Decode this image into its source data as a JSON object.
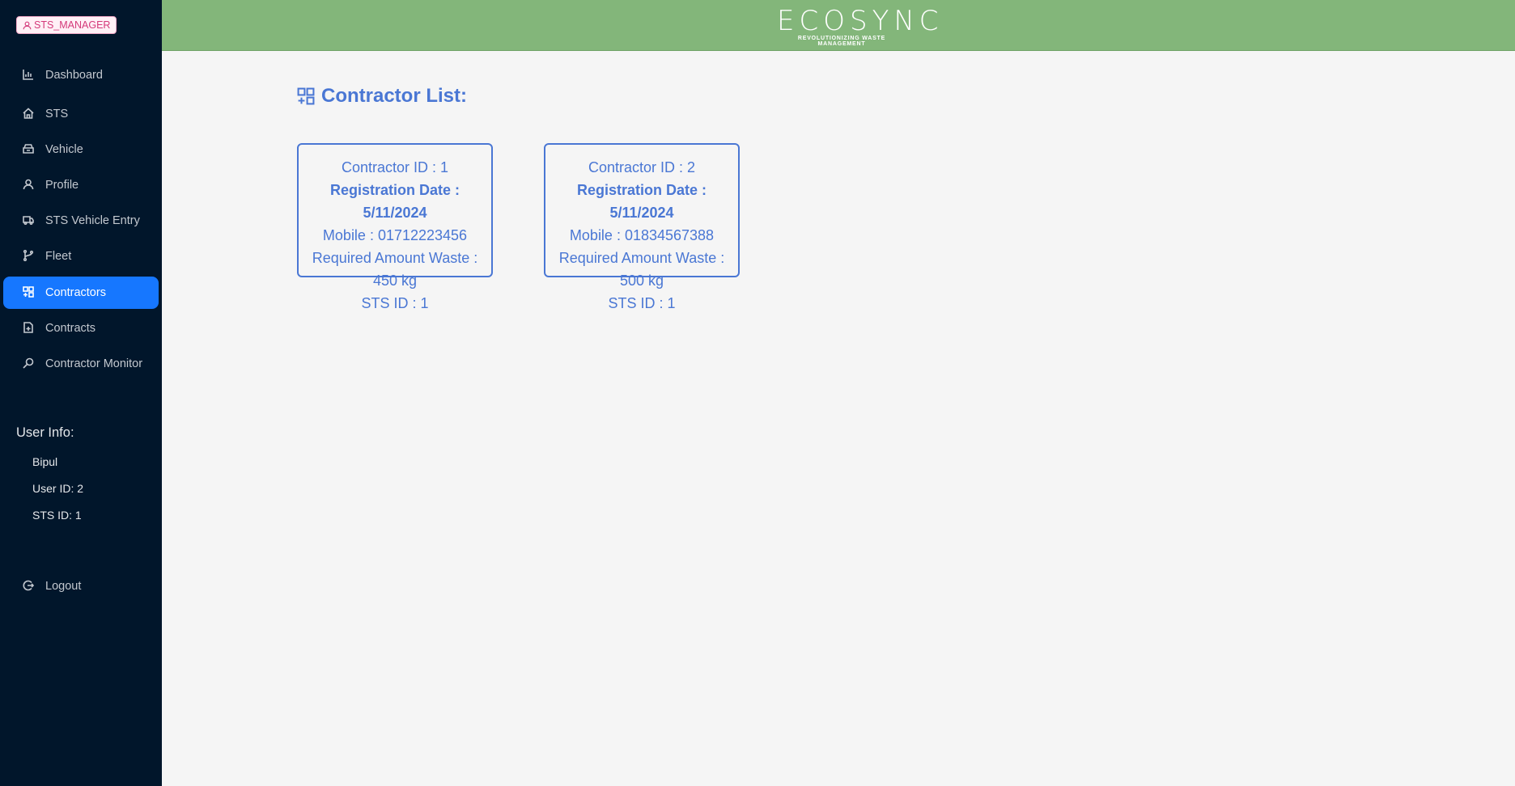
{
  "role_badge": "STS_MANAGER",
  "nav": [
    {
      "label": "Dashboard",
      "icon": "bar-chart-icon"
    },
    {
      "label": "STS",
      "icon": "home-icon"
    },
    {
      "label": "Vehicle",
      "icon": "car-icon"
    },
    {
      "label": "Profile",
      "icon": "user-icon"
    },
    {
      "label": "STS Vehicle Entry",
      "icon": "truck-icon"
    },
    {
      "label": "Fleet",
      "icon": "branch-icon"
    },
    {
      "label": "Contractors",
      "icon": "appstore-add-icon",
      "active": true
    },
    {
      "label": "Contracts",
      "icon": "file-add-icon"
    },
    {
      "label": "Contractor Monitor",
      "icon": "monitor-search-icon"
    }
  ],
  "user_info": {
    "title": "User Info:",
    "name": "Bipul",
    "user_id": "User ID: 2",
    "sts_id": "STS ID: 1"
  },
  "logout": "Logout",
  "logo": {
    "name": "ECOSYNC",
    "tagline": "REVOLUTIONIZING WASTE MANAGEMENT"
  },
  "page_title": "Contractor List:",
  "contractors": [
    {
      "id": "Contractor ID : 1",
      "date": "Registration Date : 5/11/2024",
      "mobile": "Mobile : 01712223456",
      "waste": "Required Amount Waste : 450 kg",
      "sts": "STS ID : 1"
    },
    {
      "id": "Contractor ID : 2",
      "date": "Registration Date : 5/11/2024",
      "mobile": "Mobile : 01834567388",
      "waste": "Required Amount Waste : 500 kg",
      "sts": "STS ID : 1"
    }
  ],
  "colors": {
    "sidebar": "#01162b",
    "header": "#83b67a",
    "accent": "#1677ff",
    "text": "#4a77d4"
  }
}
